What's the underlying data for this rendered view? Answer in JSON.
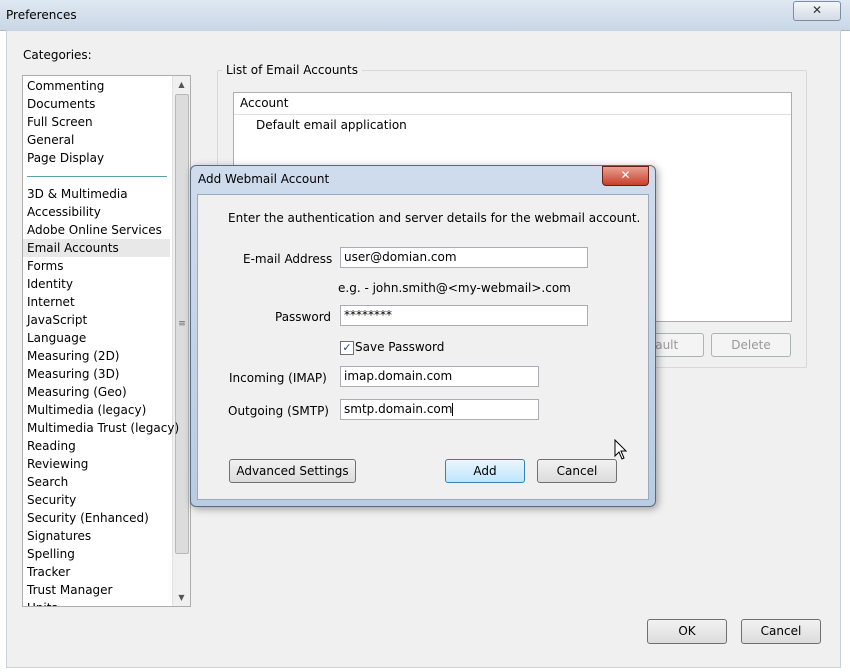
{
  "prefs": {
    "title": "Preferences",
    "close": "✕",
    "categories_label": "Categories:",
    "categories_group1": [
      "Commenting",
      "Documents",
      "Full Screen",
      "General",
      "Page Display"
    ],
    "categories_group2": [
      "3D & Multimedia",
      "Accessibility",
      "Adobe Online Services",
      "Email Accounts",
      "Forms",
      "Identity",
      "Internet",
      "JavaScript",
      "Language",
      "Measuring (2D)",
      "Measuring (3D)",
      "Measuring (Geo)",
      "Multimedia (legacy)",
      "Multimedia Trust (legacy)",
      "Reading",
      "Reviewing",
      "Search",
      "Security",
      "Security (Enhanced)",
      "Signatures",
      "Spelling",
      "Tracker",
      "Trust Manager",
      "Units"
    ],
    "selected_category": "Email Accounts",
    "email_group_label": "List of Email Accounts",
    "accounts_header": "Account",
    "accounts_rows": [
      "Default email application"
    ],
    "set_default_label": "fault",
    "delete_label": "Delete",
    "ok_label": "OK",
    "cancel_label": "Cancel"
  },
  "dialog": {
    "title": "Add Webmail Account",
    "close": "✕",
    "intro": "Enter the authentication and server details for the webmail account.",
    "email_label": "E-mail Address",
    "email_value": "user@domian.com",
    "email_hint": "e.g. - john.smith@<my-webmail>.com",
    "password_label": "Password",
    "password_value": "********",
    "save_password_label": "Save Password",
    "save_password_checked": "✓",
    "incoming_label": "Incoming (IMAP)",
    "incoming_value": "imap.domain.com",
    "outgoing_label": "Outgoing (SMTP)",
    "outgoing_value": "smtp.domain.com",
    "advanced_label": "Advanced Settings",
    "add_label": "Add",
    "cancel_label": "Cancel"
  },
  "icons": {
    "scroll_up": "▲",
    "scroll_down": "▼",
    "grip": "≡"
  }
}
